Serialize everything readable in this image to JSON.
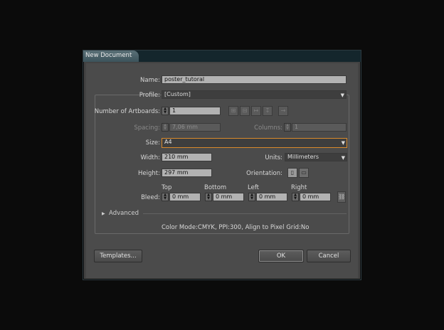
{
  "dialog": {
    "title": "New Document"
  },
  "name": {
    "label": "Name:",
    "value": "poster_tutoral"
  },
  "profile": {
    "label": "Profile:",
    "value": "[Custom]"
  },
  "artboards": {
    "label": "Number of Artboards:",
    "value": "1"
  },
  "spacing": {
    "label": "Spacing:",
    "value": "7,06 mm"
  },
  "columns": {
    "label": "Columns:",
    "value": "1"
  },
  "size": {
    "label": "Size:",
    "value": "A4"
  },
  "width": {
    "label": "Width:",
    "value": "210 mm"
  },
  "units": {
    "label": "Units:",
    "value": "Millimeters"
  },
  "height": {
    "label": "Height:",
    "value": "297 mm"
  },
  "orientation": {
    "label": "Orientation:"
  },
  "bleed": {
    "label": "Bleed:",
    "top_label": "Top",
    "top": "0 mm",
    "bottom_label": "Bottom",
    "bottom": "0 mm",
    "left_label": "Left",
    "left": "0 mm",
    "right_label": "Right",
    "right": "0 mm"
  },
  "advanced": {
    "label": "Advanced"
  },
  "summary": "Color Mode:CMYK, PPI:300, Align to Pixel Grid:No",
  "buttons": {
    "templates": "Templates...",
    "ok": "OK",
    "cancel": "Cancel"
  },
  "icons": [
    "grid-by-row-icon",
    "grid-by-column-icon",
    "arrange-by-row-icon",
    "arrange-by-column-icon",
    "right-to-left-icon",
    "portrait-icon",
    "landscape-icon",
    "link-icon",
    "triangle-right-icon",
    "chevron-down-icon"
  ]
}
